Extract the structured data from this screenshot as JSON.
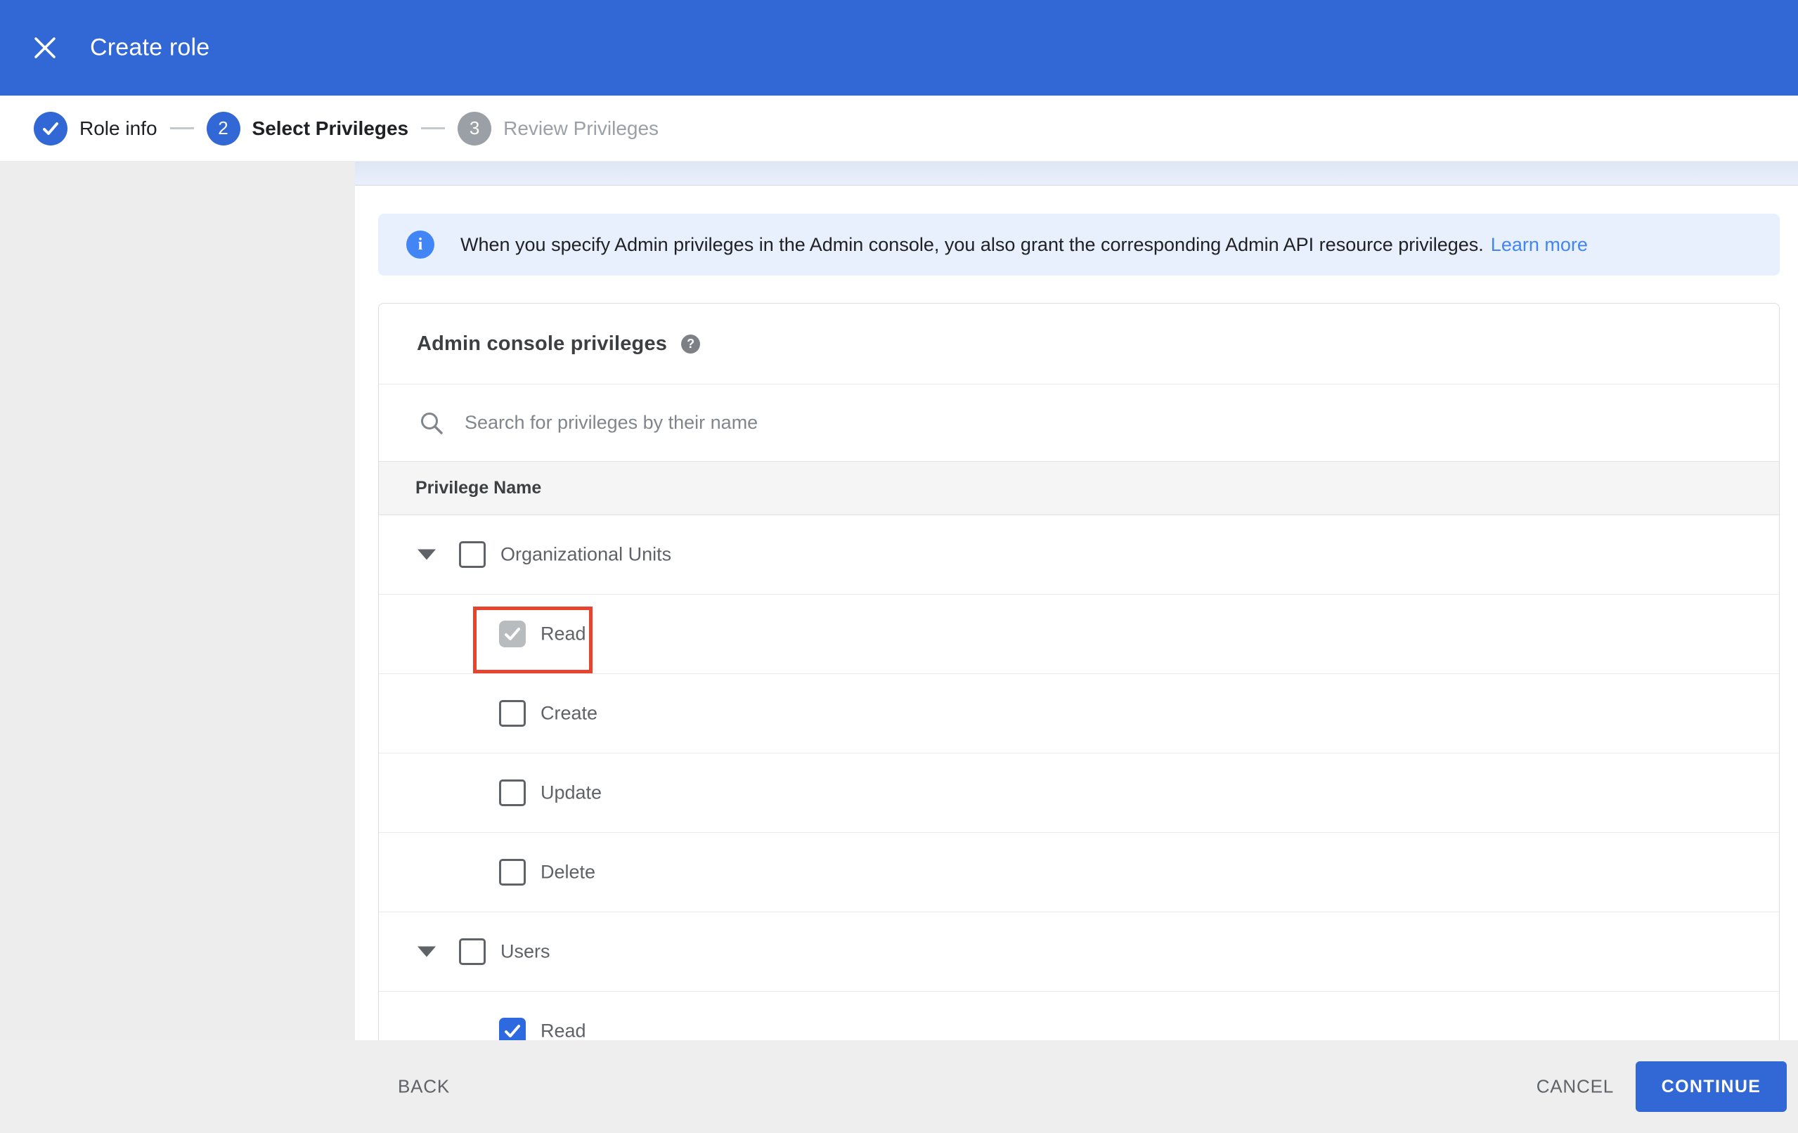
{
  "header": {
    "title": "Create role"
  },
  "stepper": {
    "steps": [
      {
        "label": "Role info",
        "state": "complete"
      },
      {
        "number": "2",
        "label": "Select Privileges",
        "state": "active"
      },
      {
        "number": "3",
        "label": "Review Privileges",
        "state": "upcoming"
      }
    ]
  },
  "banner": {
    "text": "When you specify Admin privileges in the Admin console, you also grant the corresponding Admin API resource privileges.",
    "link_label": "Learn more"
  },
  "icons": {
    "info": "i",
    "help": "?"
  },
  "card": {
    "title": "Admin console privileges",
    "search_placeholder": "Search for privileges by their name",
    "column_header": "Privilege Name",
    "rows": [
      {
        "label": "Organizational Units",
        "level": "group",
        "checked": false,
        "expanded": true
      },
      {
        "label": "Read",
        "level": "child",
        "checked": true,
        "checkbox_style": "gray-disabled",
        "highlighted": true
      },
      {
        "label": "Create",
        "level": "child",
        "checked": false
      },
      {
        "label": "Update",
        "level": "child",
        "checked": false
      },
      {
        "label": "Delete",
        "level": "child",
        "checked": false
      },
      {
        "label": "Users",
        "level": "group",
        "checked": false,
        "expanded": true
      },
      {
        "label": "Read",
        "level": "child",
        "checked": true,
        "checkbox_style": "blue",
        "clipped": true
      }
    ]
  },
  "footer": {
    "back_label": "BACK",
    "cancel_label": "CANCEL",
    "continue_label": "CONTINUE"
  },
  "colors": {
    "header_blue": "#3267d6",
    "banner_bg": "#e8f0fe",
    "link_blue": "#4285f4",
    "highlight_red": "#e8432c",
    "checkbox_blue": "#2d6ae0",
    "checkbox_disabled_gray": "#b9bcbf"
  }
}
